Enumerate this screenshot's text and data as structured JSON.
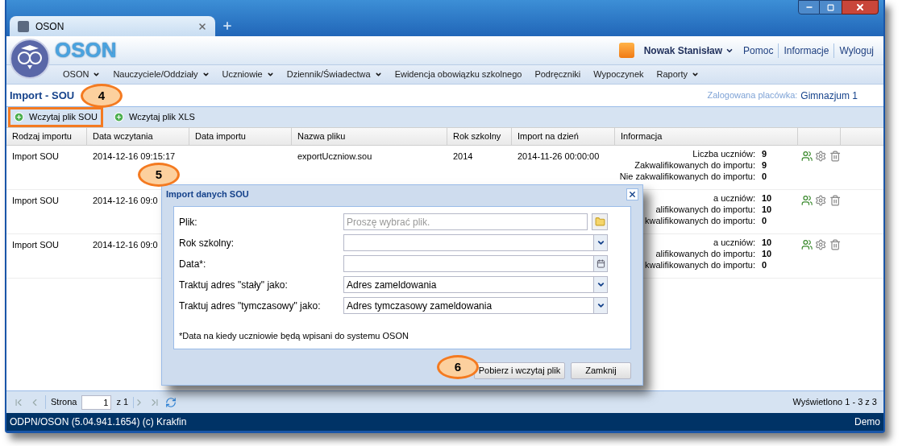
{
  "window": {
    "tab_title": "OSON"
  },
  "header": {
    "app_name": "OSON",
    "user": "Nowak Stanisław",
    "links": [
      "Pomoc",
      "Informacje",
      "Wyloguj"
    ]
  },
  "menu": [
    {
      "label": "OSON",
      "has_dropdown": true
    },
    {
      "label": "Nauczyciele/Oddziały",
      "has_dropdown": true
    },
    {
      "label": "Uczniowie",
      "has_dropdown": true
    },
    {
      "label": "Dziennik/Świadectwa",
      "has_dropdown": true
    },
    {
      "label": "Ewidencja obowiązku szkolnego",
      "has_dropdown": false
    },
    {
      "label": "Podręczniki",
      "has_dropdown": false
    },
    {
      "label": "Wypoczynek",
      "has_dropdown": false
    },
    {
      "label": "Raporty",
      "has_dropdown": true
    }
  ],
  "page": {
    "title": "Import - SOU",
    "facility_label": "Zalogowana placówka:",
    "facility": "Gimnazjum 1"
  },
  "toolbar": [
    {
      "label": "Wczytaj plik SOU",
      "highlighted": true
    },
    {
      "label": "Wczytaj plik XLS",
      "highlighted": false
    }
  ],
  "table": {
    "columns": [
      "Rodzaj importu",
      "Data wczytania",
      "Data importu",
      "Nazwa pliku",
      "Rok szkolny",
      "Import na dzień",
      "Informacja"
    ],
    "rows": [
      {
        "type": "Import SOU",
        "loaded": "2014-12-16 09:15:17",
        "file": "exportUczniow.sou",
        "school_year": "2014",
        "import_date": "2014-11-26 00:00:00",
        "info": [
          {
            "label": "Liczba uczniów:",
            "value": "9"
          },
          {
            "label": "Zakwalifikowanych do importu:",
            "value": "9"
          },
          {
            "label": "Nie zakwalifikowanych do importu:",
            "value": "0"
          }
        ]
      },
      {
        "type": "Import SOU",
        "loaded": "2014-12-16 09:0",
        "info": [
          {
            "label": "a uczniów:",
            "value": "10"
          },
          {
            "label": "alifikowanych do importu:",
            "value": "10"
          },
          {
            "label": "kwalifikowanych do importu:",
            "value": "0"
          }
        ]
      },
      {
        "type": "Import SOU",
        "loaded": "2014-12-16 09:0",
        "info": [
          {
            "label": "a uczniów:",
            "value": "10"
          },
          {
            "label": "alifikowanych do importu:",
            "value": "10"
          },
          {
            "label": "kwalifikowanych do importu:",
            "value": "0"
          }
        ]
      }
    ]
  },
  "pager": {
    "page_label": "Strona",
    "page": "1",
    "of": "z 1",
    "summary": "Wyświetlono 1 - 3 z 3"
  },
  "status_bar": {
    "left": "ODPN/OSON (5.04.941.1654) (c) Krakfin",
    "right": "Demo"
  },
  "dialog": {
    "title": "Import danych SOU",
    "fields": [
      {
        "label": "Plik:",
        "kind": "file",
        "placeholder": "Proszę wybrać plik."
      },
      {
        "label": "Rok szkolny:",
        "kind": "select"
      },
      {
        "label": "Data*:",
        "kind": "date"
      },
      {
        "label": "Traktuj adres \"stały\" jako:",
        "kind": "select",
        "value": "Adres zameldowania"
      },
      {
        "label": "Traktuj adres \"tymczasowy\" jako:",
        "kind": "select",
        "value": "Adres tymczasowy zameldowania"
      }
    ],
    "note": "*Data na kiedy uczniowie będą wpisani do systemu OSON",
    "buttons": [
      "Pobierz i wczytaj plik",
      "Zamknij"
    ]
  },
  "callouts": [
    "4",
    "5",
    "6"
  ]
}
